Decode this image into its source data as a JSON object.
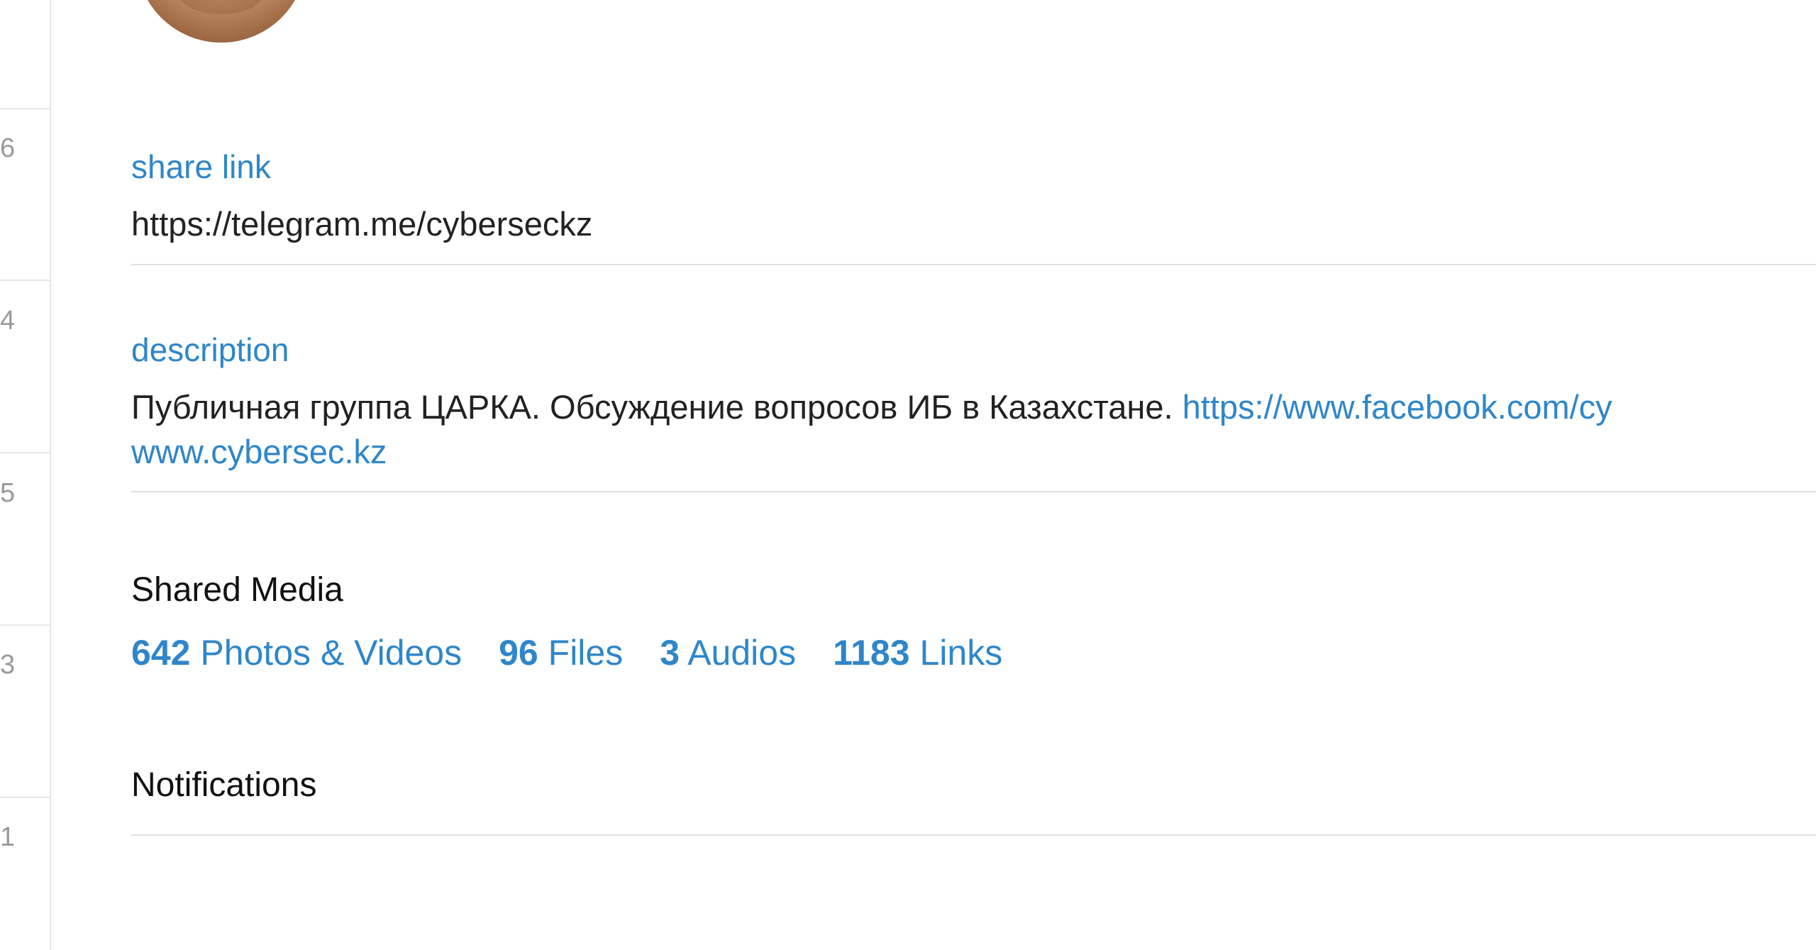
{
  "sidebar_strip": {
    "counts": [
      "6",
      "4",
      "5",
      "3",
      "1"
    ]
  },
  "share_link": {
    "label": "share link",
    "value": "https://telegram.me/cyberseckz"
  },
  "description": {
    "label": "description",
    "text": "Публичная группа ЦАРКА. Обсуждение вопросов ИБ в Казахстане. ",
    "link1": "https://www.facebook.com/cy",
    "link2": "www.cybersec.kz"
  },
  "shared_media": {
    "heading": "Shared Media",
    "items": [
      {
        "count": "642",
        "label": "Photos & Videos"
      },
      {
        "count": "96",
        "label": "Files"
      },
      {
        "count": "3",
        "label": "Audios"
      },
      {
        "count": "1183",
        "label": "Links"
      }
    ]
  },
  "notifications": {
    "heading": "Notifications"
  },
  "colors": {
    "accent": "#2f86c9",
    "text": "#222222",
    "divider": "#e0e0e0",
    "muted": "#9a9a9a"
  }
}
